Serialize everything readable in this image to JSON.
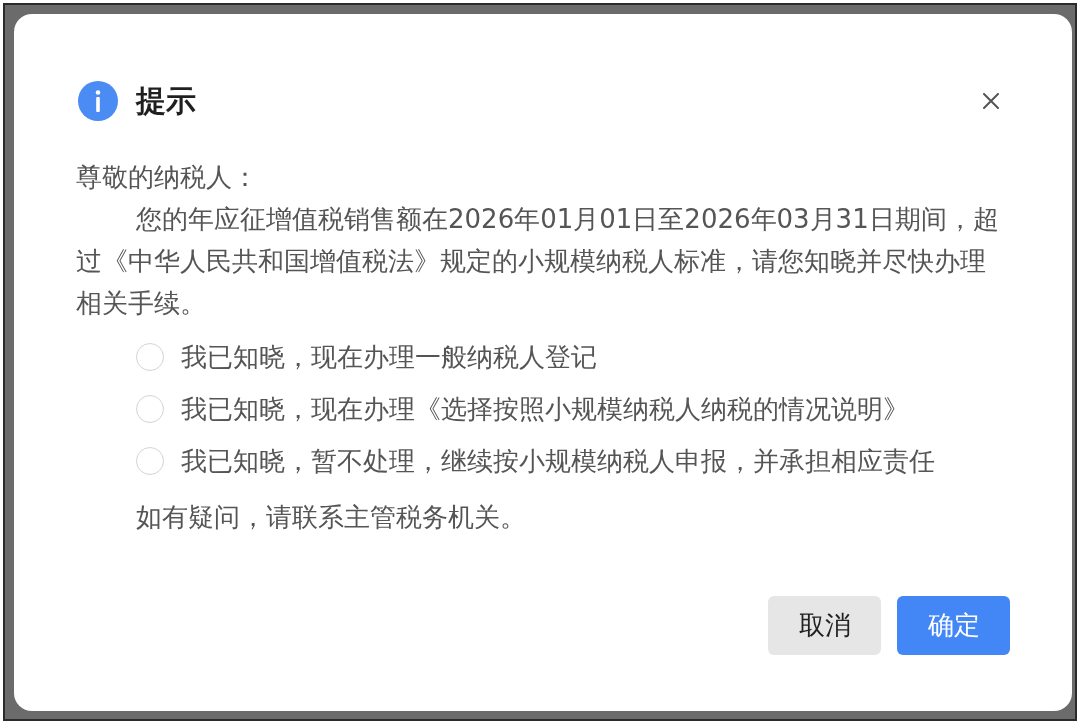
{
  "dialog": {
    "title": "提示",
    "greeting": "尊敬的纳税人：",
    "message": "您的年应征增值税销售额在2026年01月01日至2026年03月31日期间，超过《中华人民共和国增值税法》规定的小规模纳税人标准，请您知晓并尽快办理相关手续。",
    "options": [
      {
        "label": "我已知晓，现在办理一般纳税人登记",
        "selected": false
      },
      {
        "label": "我已知晓，现在办理《选择按照小规模纳税人纳税的情况说明》",
        "selected": false
      },
      {
        "label": "我已知晓，暂不处理，继续按小规模纳税人申报，并承担相应责任",
        "selected": false
      }
    ],
    "note": "如有疑问，请联系主管税务机关。",
    "buttons": [
      {
        "label": "取消",
        "kind": "secondary"
      },
      {
        "label": "确定",
        "kind": "primary"
      }
    ]
  }
}
